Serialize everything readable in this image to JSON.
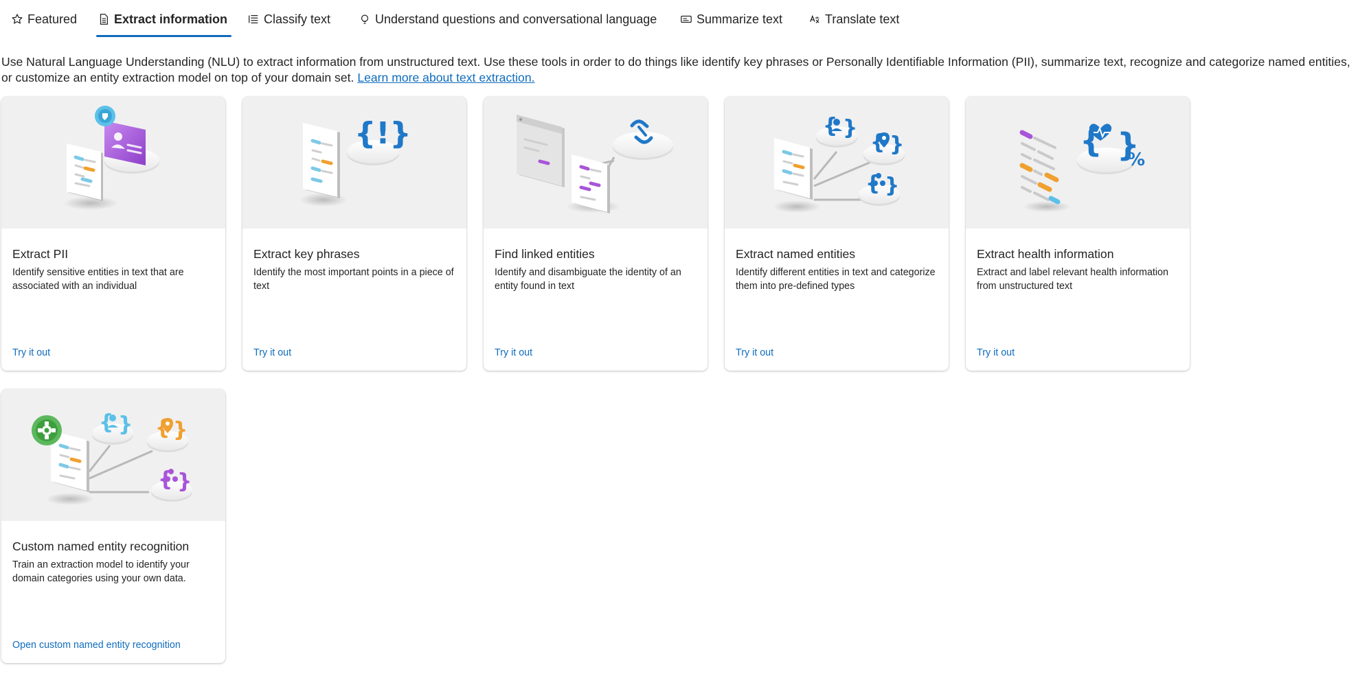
{
  "tabs": [
    {
      "label": "Featured",
      "icon": "star-icon"
    },
    {
      "label": "Extract information",
      "icon": "document-icon",
      "active": true
    },
    {
      "label": "Classify text",
      "icon": "list-icon"
    },
    {
      "label": "Understand questions and conversational language",
      "icon": "chat-bulb-icon"
    },
    {
      "label": "Summarize text",
      "icon": "summary-icon"
    },
    {
      "label": "Translate text",
      "icon": "translate-icon"
    }
  ],
  "intro": {
    "text": "Use Natural Language Understanding (NLU) to extract information from unstructured text. Use these tools in order to do things like identify key phrases or Personally Identifiable Information (PII), summarize text, recognize and categorize named entities, or customize an entity extraction model on top of your domain set.",
    "link": "Learn more about text extraction."
  },
  "cards": [
    {
      "title": "Extract PII",
      "description": "Identify sensitive entities in text that are associated with an individual",
      "link": "Try it out"
    },
    {
      "title": "Extract key phrases",
      "description": "Identify the most important points in a piece of text",
      "link": "Try it out"
    },
    {
      "title": "Find linked entities",
      "description": "Identify and disambiguate the identity of an entity found in text",
      "link": "Try it out"
    },
    {
      "title": "Extract named entities",
      "description": "Identify different entities in text and categorize them into pre-defined types",
      "link": "Try it out"
    },
    {
      "title": "Extract health information",
      "description": "Extract and label relevant health information from unstructured text",
      "link": "Try it out"
    },
    {
      "title": "Custom named entity recognition",
      "description": "Train an extraction model to identify your domain categories using your own data.",
      "link": "Open custom named entity recognition"
    }
  ],
  "colors": {
    "accent": "#0f6cbd",
    "card_art_bg": "#f0f0f0",
    "purple": "#a855d9",
    "orange": "#f0a030",
    "light_blue": "#5cc0e8",
    "green": "#5cb85c"
  }
}
